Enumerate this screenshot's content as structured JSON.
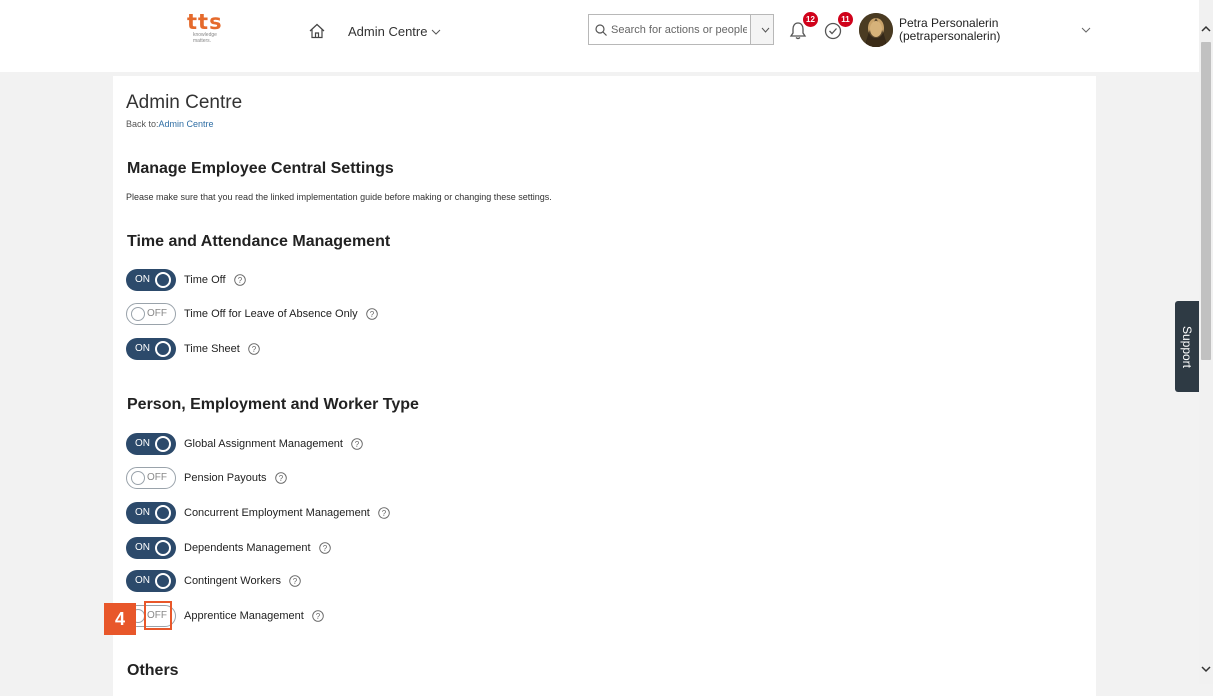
{
  "header": {
    "logo_main": "tts",
    "logo_sub_1": "knowledge",
    "logo_sub_2": "matters.",
    "nav_label": "Admin Centre",
    "search_placeholder": "Search for actions or people",
    "notifications_count": "12",
    "tasks_count": "11",
    "user_name": "Petra Personalerin",
    "user_id": "(petrapersonalerin)"
  },
  "page": {
    "title": "Admin Centre",
    "back_prefix": "Back to:",
    "back_link": "Admin Centre",
    "heading": "Manage Employee Central Settings",
    "note": "Please make sure that you read the linked implementation guide before making or changing these settings."
  },
  "sections": [
    {
      "title": "Time and Attendance Management",
      "items": [
        {
          "label": "Time Off",
          "state": "ON"
        },
        {
          "label": "Time Off for Leave of Absence Only",
          "state": "OFF"
        },
        {
          "label": "Time Sheet",
          "state": "ON"
        }
      ]
    },
    {
      "title": "Person, Employment and Worker Type",
      "items": [
        {
          "label": "Global Assignment Management",
          "state": "ON"
        },
        {
          "label": "Pension Payouts",
          "state": "OFF"
        },
        {
          "label": "Concurrent Employment Management",
          "state": "ON"
        },
        {
          "label": "Dependents Management",
          "state": "ON"
        },
        {
          "label": "Contingent Workers",
          "state": "ON"
        },
        {
          "label": "Apprentice Management",
          "state": "OFF"
        }
      ]
    },
    {
      "title": "Others",
      "items": []
    }
  ],
  "support_label": "Support",
  "step_number": "4",
  "colors": {
    "accent": "#e56a2c",
    "toggle_on": "#2c4a6b",
    "step": "#e8572a"
  }
}
